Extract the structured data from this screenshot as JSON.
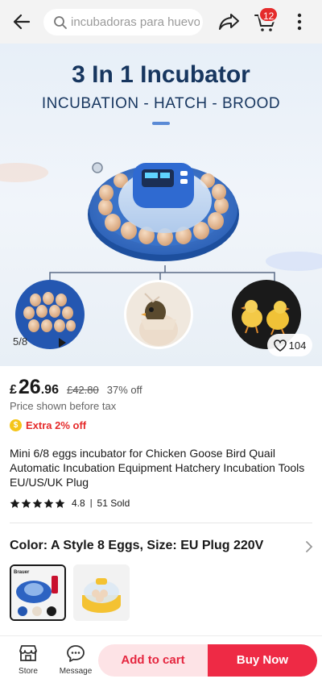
{
  "header": {
    "search_placeholder": "incubadoras para huevos...",
    "cart_count": "12"
  },
  "hero": {
    "title": "3 In 1 Incubator",
    "subtitle": "INCUBATION - HATCH - BROOD",
    "slide_counter": "5/8",
    "wishlist_count": "104"
  },
  "price": {
    "currency": "£",
    "integer": "26",
    "decimal": ".96",
    "original": "£42.80",
    "discount": "37% off",
    "tax_note": "Price shown before tax",
    "extra_offer": "Extra 2% off"
  },
  "product": {
    "title": "Mini 6/8 eggs incubator for Chicken Goose Bird Quail Automatic Incubation Equipment Hatchery Incubation Tools EU/US/UK Plug",
    "rating": "4.8",
    "sold": "51 Sold"
  },
  "sku": {
    "label": "Color: A Style 8 Eggs, Size: EU Plug 220V",
    "thumb1_brand": "Brauer"
  },
  "bottom": {
    "store_label": "Store",
    "message_label": "Message",
    "add_to_cart": "Add to cart",
    "buy_now": "Buy Now"
  },
  "colors": {
    "accent": "#ee2a45",
    "accent_light": "#fde3e6",
    "hero_title": "#17365f",
    "badge": "#e52b2b"
  }
}
